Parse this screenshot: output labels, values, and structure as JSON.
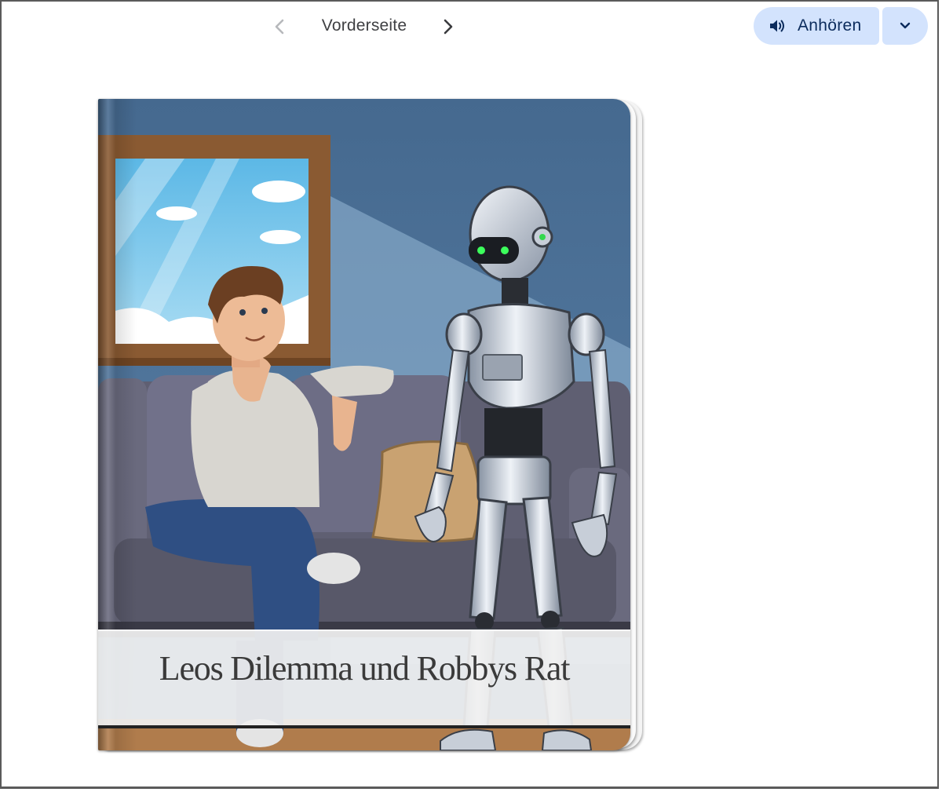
{
  "viewer": {
    "page_label": "Vorderseite",
    "listen_label": "Anhören"
  },
  "book": {
    "title": "Leos Dilemma und Robbys Rat"
  },
  "colors": {
    "accent_bg": "#d3e3fd",
    "accent_text": "#0b2b5c"
  },
  "icons": {
    "prev": "chevron-left-icon",
    "next": "chevron-right-icon",
    "listen": "speaker-icon",
    "dropdown": "chevron-down-icon"
  }
}
